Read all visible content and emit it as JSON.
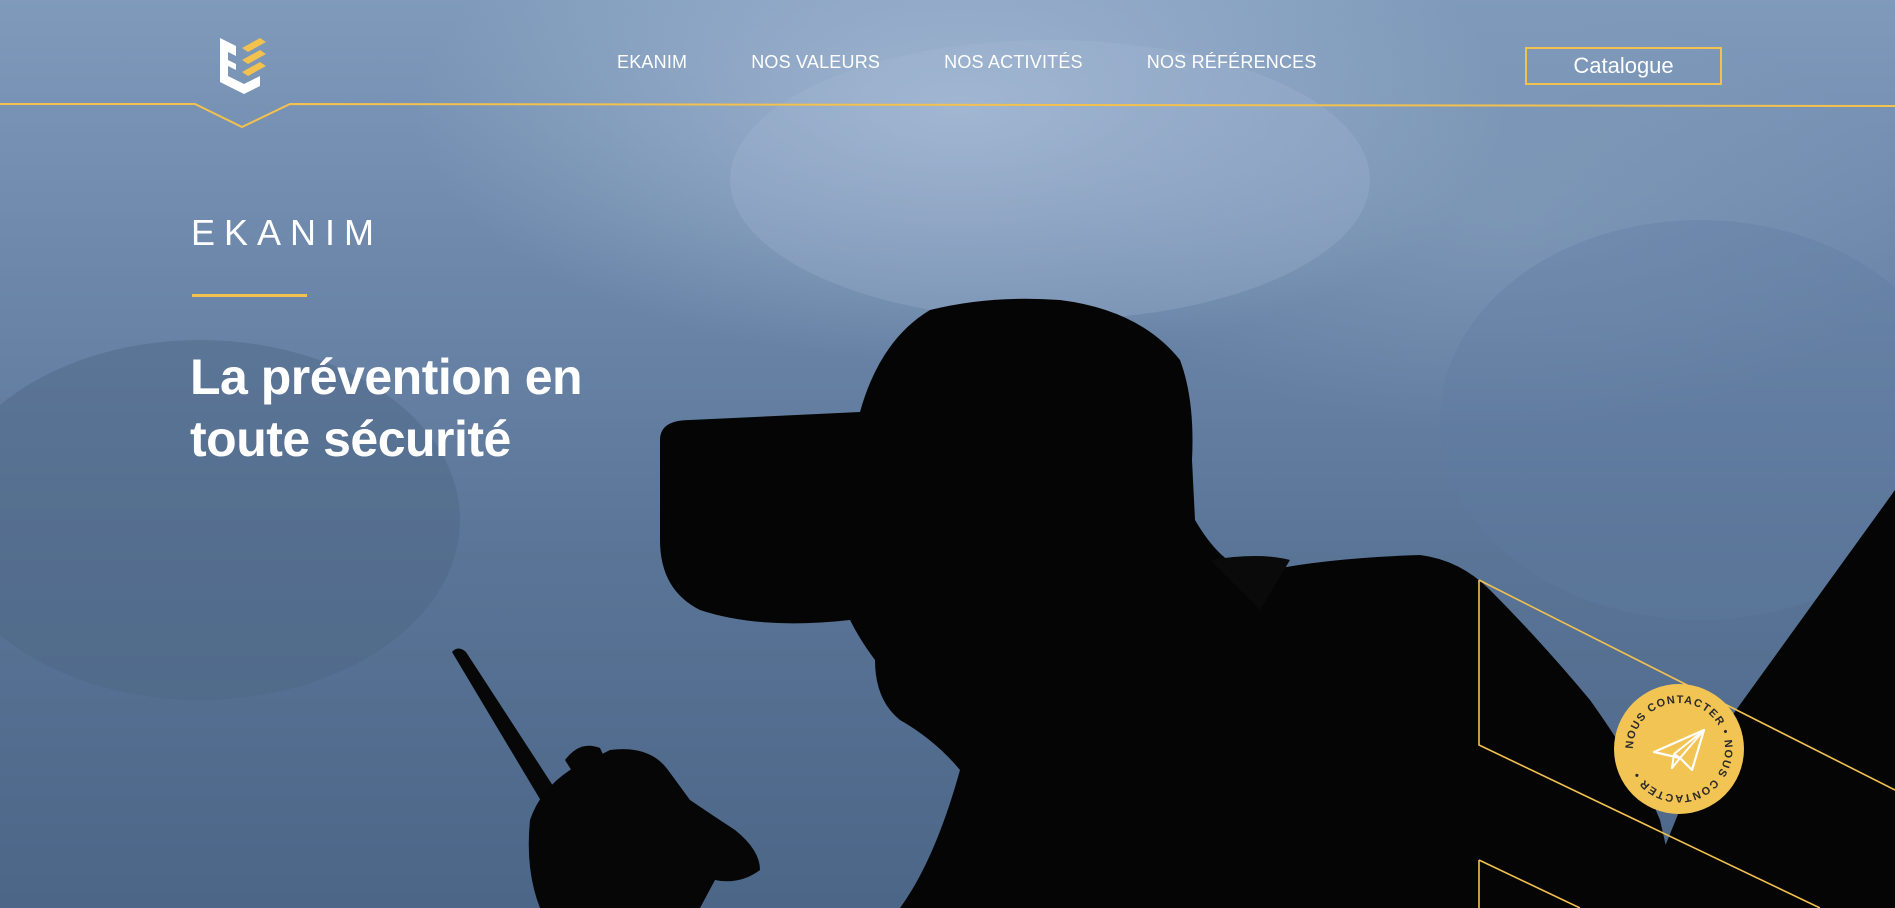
{
  "nav": {
    "items": [
      {
        "label": "EKANIM"
      },
      {
        "label": "NOS VALEURS"
      },
      {
        "label": "NOS ACTIVITÉS"
      },
      {
        "label": "NOS RÉFÉRENCES"
      }
    ],
    "catalogue_label": "Catalogue"
  },
  "hero": {
    "brand": "EKANIM",
    "tagline_line1": "La prévention en",
    "tagline_line2": "toute sécurité"
  },
  "contact": {
    "ring_text": "NOUS CONTACTER • NOUS CONTACTER •",
    "icon": "paper-plane-icon"
  },
  "colors": {
    "accent": "#f2c14e",
    "text": "#ffffff"
  }
}
